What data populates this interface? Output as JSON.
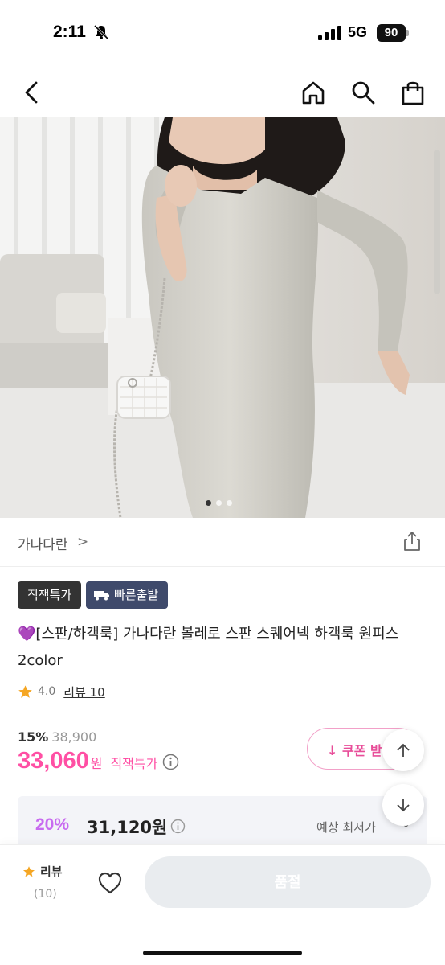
{
  "status_bar": {
    "time": "2:11",
    "network": "5G",
    "battery": "90"
  },
  "nav": {
    "back_icon": "chevron-left-icon",
    "home_icon": "home-icon",
    "search_icon": "search-icon",
    "cart_icon": "shopping-bag-icon"
  },
  "gallery": {
    "current_index": 1,
    "total": 3
  },
  "brand": {
    "name": "가나다란",
    "chevron": ">"
  },
  "badges": {
    "deal": "직잭특가",
    "shipping": "빠른출발"
  },
  "product": {
    "title_emoji": "💜",
    "title": "[스판/하객룩] 가나다란 볼레로 스판 스퀘어넥 하객룩 원피스 2color",
    "rating": "4.0",
    "review_label": "리뷰 10",
    "discount": "15%",
    "original_price": "38,900",
    "sale_price": "33,060",
    "currency": "원",
    "deal_label": "직잭특가"
  },
  "coupon": {
    "label": "↓ 쿠폰 받"
  },
  "best_price": {
    "percent": "20%",
    "price": "31,120원",
    "label": "예상 최저가"
  },
  "bottom_bar": {
    "review_label": "리뷰",
    "review_count": "(10)",
    "soldout_label": "품절"
  },
  "colors": {
    "accent_pink": "#ff4fa4",
    "accent_purple": "#c86bf0",
    "badge_dark": "#333333",
    "badge_navy": "#3f4a6b",
    "star": "#f5a623"
  }
}
